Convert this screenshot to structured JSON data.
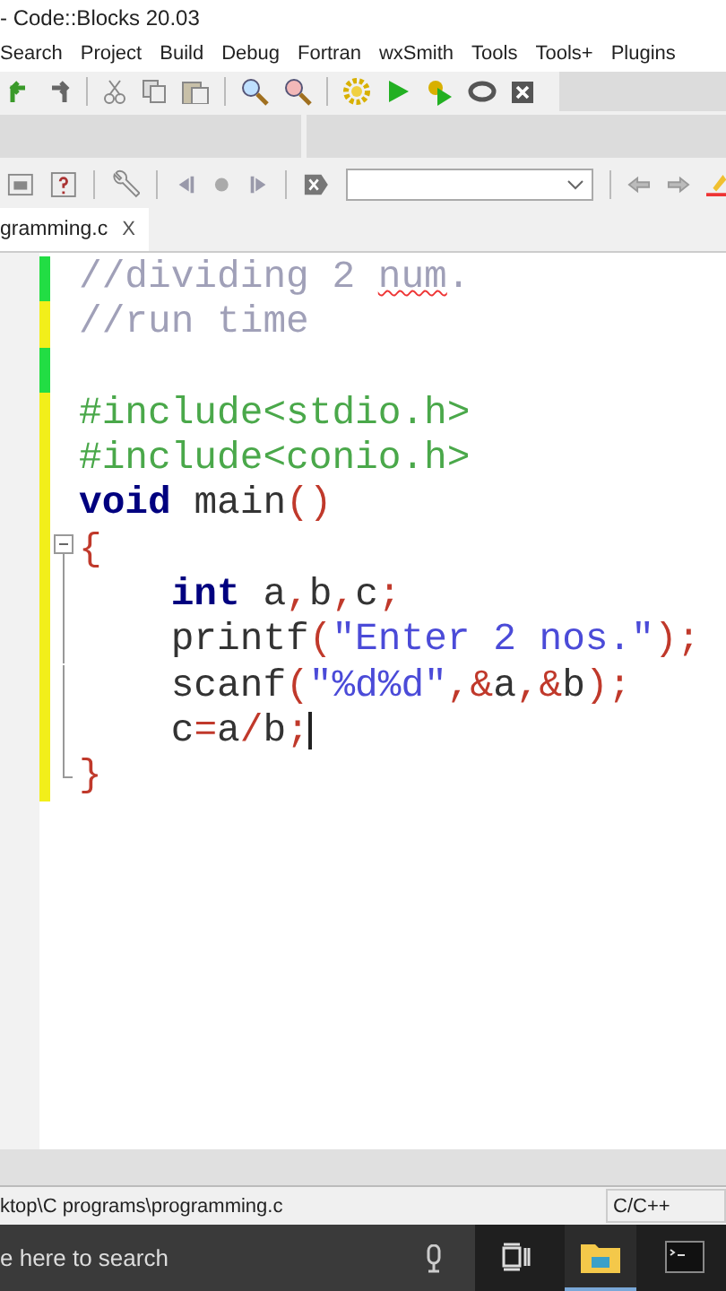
{
  "window": {
    "title": "- Code::Blocks 20.03"
  },
  "menu": [
    "Search",
    "Project",
    "Build",
    "Debug",
    "Fortran",
    "wxSmith",
    "Tools",
    "Tools+",
    "Plugins"
  ],
  "tabs": [
    {
      "label": "gramming.c",
      "close": "X",
      "selected": true
    }
  ],
  "code_lines": [
    {
      "color": "#22dd44",
      "kind": "plain",
      "tokens": [
        {
          "kind": "comment",
          "text": "//dividing 2 "
        },
        {
          "kind": "misspelled",
          "text": "num"
        },
        {
          "kind": "comment",
          "text": "."
        }
      ]
    },
    {
      "color": "#f2ef1a",
      "kind": "plain",
      "tokens": [
        {
          "kind": "comment",
          "text": "//run time"
        }
      ]
    },
    {
      "color": "#22dd44",
      "kind": "plain"
    },
    {
      "color": "#f2ef1a",
      "kind": "plain",
      "tokens": [
        {
          "kind": "preproc",
          "text": "#include<stdio.h>"
        }
      ]
    },
    {
      "color": "#f2ef1a",
      "kind": "plain",
      "tokens": [
        {
          "kind": "preproc",
          "text": "#include<conio.h>"
        }
      ]
    },
    {
      "color": "#f2ef1a",
      "kind": "plain",
      "tokens": [
        {
          "kind": "keyword",
          "text": "void"
        },
        {
          "kind": "plain",
          "text": " main"
        },
        {
          "kind": "operator",
          "text": "()"
        }
      ]
    },
    {
      "color": "#f2ef1a",
      "kind": "foldstart",
      "tokens": [
        {
          "kind": "operator",
          "text": "{"
        }
      ]
    },
    {
      "color": "#f2ef1a",
      "kind": "foldinside",
      "tokens": [
        {
          "kind": "keyword",
          "text": "    int"
        },
        {
          "kind": "plain",
          "text": " a"
        },
        {
          "kind": "operator",
          "text": ","
        },
        {
          "kind": "plain",
          "text": "b"
        },
        {
          "kind": "operator",
          "text": ","
        },
        {
          "kind": "plain",
          "text": "c"
        },
        {
          "kind": "operator",
          "text": ";"
        }
      ]
    },
    {
      "color": "#f2ef1a",
      "kind": "foldinside",
      "tokens": [
        {
          "kind": "plain",
          "text": "    printf"
        },
        {
          "kind": "operator",
          "text": "("
        },
        {
          "kind": "string",
          "text": "\"Enter 2 nos.\""
        },
        {
          "kind": "operator",
          "text": ");"
        }
      ]
    },
    {
      "color": "#f2ef1a",
      "kind": "foldinside",
      "tokens": [
        {
          "kind": "plain",
          "text": "    scanf"
        },
        {
          "kind": "operator",
          "text": "("
        },
        {
          "kind": "string",
          "text": "\"%d%d\""
        },
        {
          "kind": "operator",
          "text": ",&"
        },
        {
          "kind": "plain",
          "text": "a"
        },
        {
          "kind": "operator",
          "text": ",&"
        },
        {
          "kind": "plain",
          "text": "b"
        },
        {
          "kind": "operator",
          "text": ");"
        }
      ]
    },
    {
      "color": "#f2ef1a",
      "kind": "foldinside",
      "caret": true,
      "tokens": [
        {
          "kind": "plain",
          "text": "    c"
        },
        {
          "kind": "operator",
          "text": "="
        },
        {
          "kind": "plain",
          "text": "a"
        },
        {
          "kind": "operator",
          "text": "/"
        },
        {
          "kind": "plain",
          "text": "b"
        },
        {
          "kind": "operator",
          "text": ";"
        }
      ]
    },
    {
      "color": "#f2ef1a",
      "kind": "foldend",
      "tokens": [
        {
          "kind": "operator",
          "text": "}"
        }
      ]
    }
  ],
  "status_bar": {
    "path": "ktop\\C programs\\programming.c",
    "language": "C/C++"
  },
  "taskbar": {
    "search_placeholder": "e here to search",
    "apps": [
      {
        "kind": "taskview",
        "selected": false
      },
      {
        "kind": "explorer",
        "selected": true
      },
      {
        "kind": "terminal",
        "selected": false
      }
    ]
  }
}
